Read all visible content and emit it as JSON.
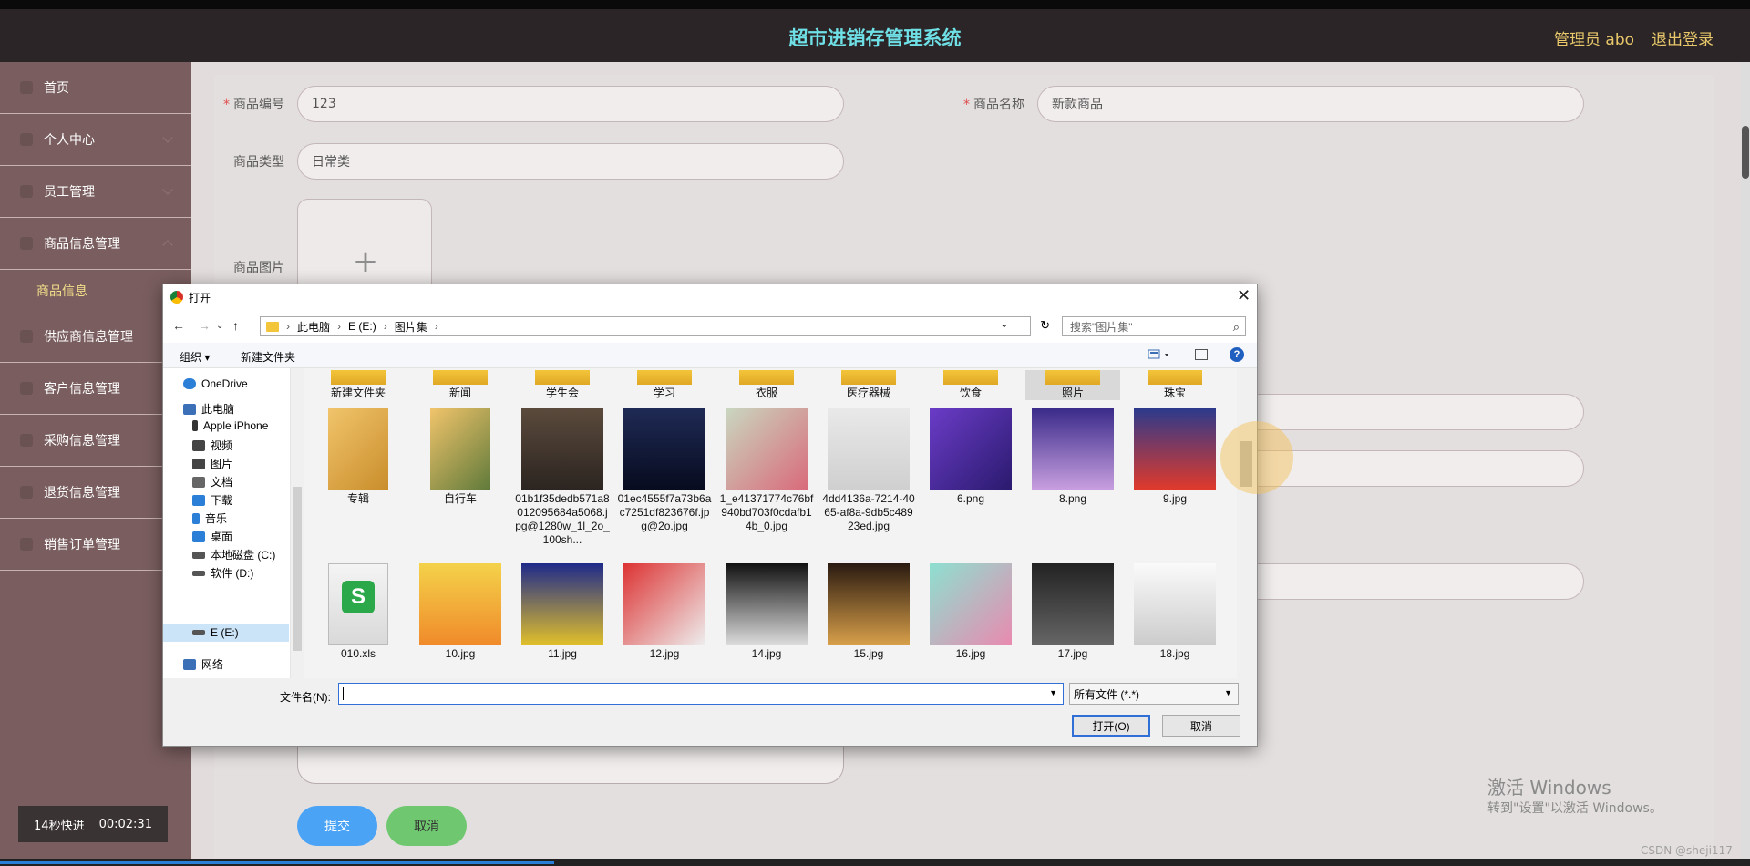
{
  "header": {
    "title": "超市进销存管理系统",
    "admin": "管理员 abo",
    "logout": "退出登录"
  },
  "sidebar": {
    "items": [
      {
        "label": "首页",
        "icon": "home-icon"
      },
      {
        "label": "个人中心",
        "icon": "user-icon"
      },
      {
        "label": "员工管理",
        "icon": "staff-icon"
      },
      {
        "label": "商品信息管理",
        "icon": "product-icon"
      },
      {
        "label": "商品信息",
        "icon": ""
      },
      {
        "label": "供应商信息管理",
        "icon": "supplier-icon"
      },
      {
        "label": "客户信息管理",
        "icon": "customer-icon"
      },
      {
        "label": "采购信息管理",
        "icon": "purchase-icon"
      },
      {
        "label": "退货信息管理",
        "icon": "return-icon"
      },
      {
        "label": "销售订单管理",
        "icon": "order-icon"
      }
    ]
  },
  "timer": {
    "label": "14秒快进",
    "time": "00:02:31"
  },
  "form": {
    "code_label": "商品编号",
    "code_value": "123",
    "name_label": "商品名称",
    "name_value": "新款商品",
    "type_label": "商品类型",
    "type_value": "日常类",
    "image_label": "商品图片",
    "upload_icon": "+",
    "submit": "提交",
    "cancel": "取消"
  },
  "watermark": {
    "line1": "激活 Windows",
    "line2": "转到\"设置\"以激活 Windows。",
    "csdn": "CSDN @sheji117"
  },
  "dialog": {
    "title": "打开",
    "close": "✕",
    "path": [
      "此电脑",
      "E (E:)",
      "图片集"
    ],
    "search_placeholder": "搜索\"图片集\"",
    "organize": "组织 ▾",
    "new_folder": "新建文件夹",
    "help": "?",
    "nav": [
      {
        "label": "OneDrive",
        "color": "#2b7fd6"
      },
      {
        "label": "此电脑",
        "color": "#3b6fb6"
      },
      {
        "label": "Apple iPhone",
        "color": "#333333"
      },
      {
        "label": "视频",
        "color": "#444444"
      },
      {
        "label": "图片",
        "color": "#444444"
      },
      {
        "label": "文档",
        "color": "#666666"
      },
      {
        "label": "下载",
        "color": "#2b7fd6"
      },
      {
        "label": "音乐",
        "color": "#2b7fd6"
      },
      {
        "label": "桌面",
        "color": "#2b7fd6"
      },
      {
        "label": "本地磁盘 (C:)",
        "color": "#555555"
      },
      {
        "label": "软件 (D:)",
        "color": "#555555"
      },
      {
        "label": "E (E:)",
        "color": "#555555"
      },
      {
        "label": "网络",
        "color": "#3b6fb6"
      }
    ],
    "row1": [
      "新建文件夹",
      "新闻",
      "学生会",
      "学习",
      "衣服",
      "医疗器械",
      "饮食",
      "照片",
      "珠宝"
    ],
    "row2": [
      "专辑",
      "自行车",
      "01b1f35dedb571a8012095684a5068.jpg@1280w_1l_2o_100sh...",
      "01ec4555f7a73b6ac7251df823676f.jpg@2o.jpg",
      "1_e41371774c76bf940bd703f0cdafb14b_0.jpg",
      "4dd4136a-7214-4065-af8a-9db5c48923ed.jpg",
      "6.png",
      "8.png",
      "9.jpg"
    ],
    "row3": [
      "010.xls",
      "10.jpg",
      "11.jpg",
      "12.jpg",
      "14.jpg",
      "15.jpg",
      "16.jpg",
      "17.jpg",
      "18.jpg"
    ],
    "filename_label": "文件名(N):",
    "filename_value": "",
    "filetype": "所有文件 (*.*)",
    "open": "打开(O)",
    "cancel": "取消"
  }
}
